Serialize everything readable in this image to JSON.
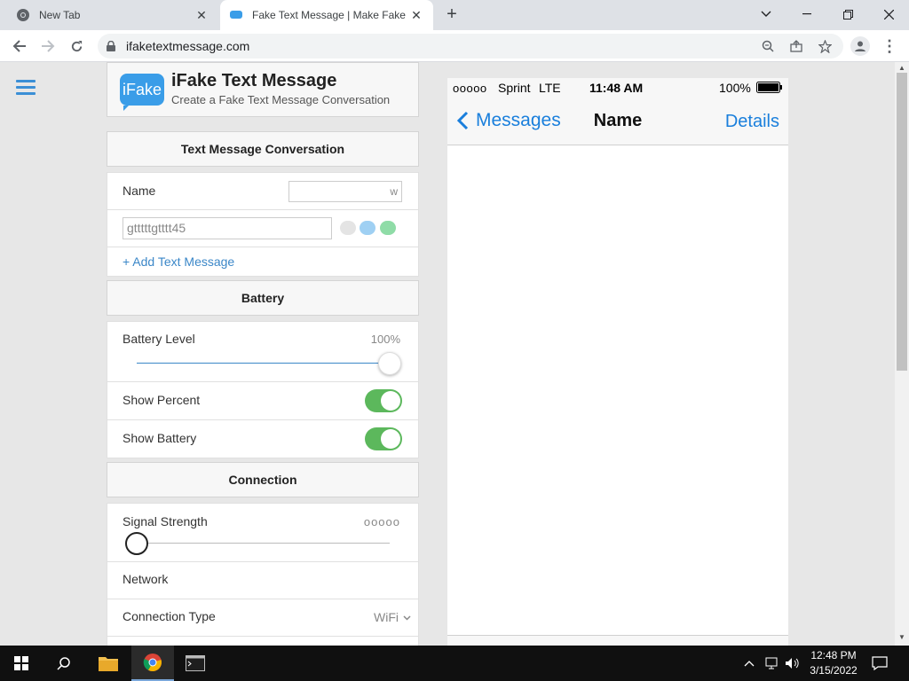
{
  "browser": {
    "tabs": [
      {
        "label": "New Tab",
        "active": false
      },
      {
        "label": "Fake Text Message | Make Fake Te",
        "active": true
      }
    ],
    "new_tab_label": "+",
    "url": "ifaketextmessage.com"
  },
  "site": {
    "logo_text": "iFake",
    "title": "iFake Text Message",
    "subtitle": "Create a Fake Text Message Conversation"
  },
  "conversation": {
    "heading": "Text Message Conversation",
    "name_label": "Name",
    "name_value": "w",
    "message_value": "gtttttgtttt45",
    "add_message": "+ Add Text Message",
    "bubble_colors": [
      "#e4e4e4",
      "#9fd0f3",
      "#8fdca7"
    ]
  },
  "battery": {
    "heading": "Battery",
    "level_label": "Battery Level",
    "level_value": "100%",
    "level_fraction": 1.0,
    "show_percent_label": "Show Percent",
    "show_percent": true,
    "show_battery_label": "Show Battery",
    "show_battery": true
  },
  "connection": {
    "heading": "Connection",
    "signal_label": "Signal Strength",
    "signal_value": "ooooo",
    "signal_fraction": 0.0,
    "network_label": "Network",
    "network_value": "",
    "type_label": "Connection Type",
    "type_value": "WiFi"
  },
  "phone": {
    "carrier_dots": "ooooo",
    "carrier": "Sprint",
    "network": "LTE",
    "time": "11:48 AM",
    "battery": "100%",
    "back_label": "Messages",
    "title": "Name",
    "details_label": "Details"
  },
  "taskbar": {
    "time": "12:48 PM",
    "date": "3/15/2022"
  },
  "colors": {
    "accent": "#1a7fdc",
    "toggle_on": "#5cb85c",
    "link": "#3b87c8"
  }
}
